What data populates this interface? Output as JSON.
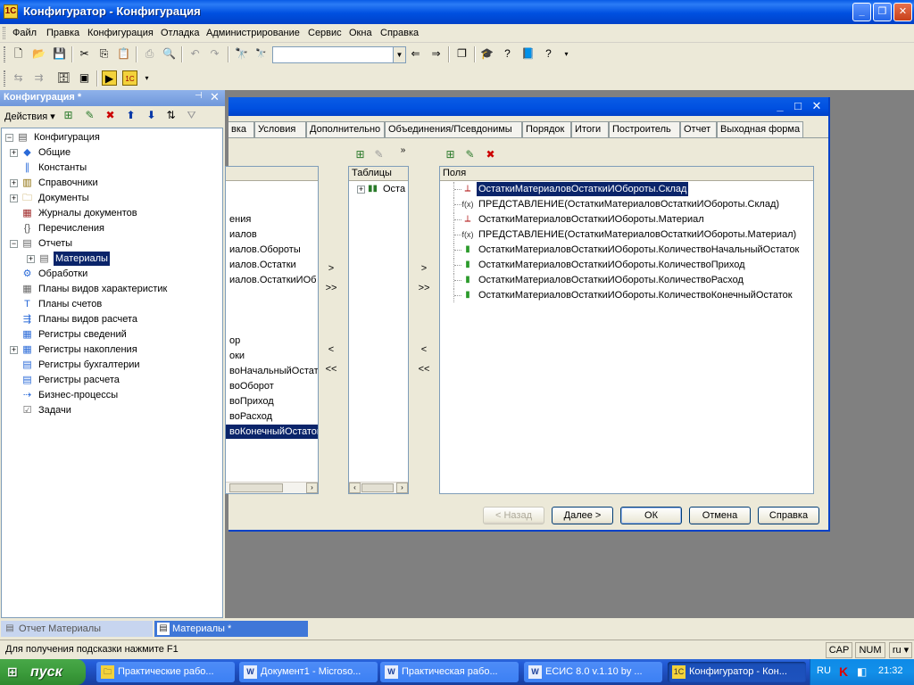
{
  "window": {
    "title": "Конфигуратор - Конфигурация",
    "icon": "1c-app-icon"
  },
  "menu": [
    "Файл",
    "Правка",
    "Конфигурация",
    "Отладка",
    "Администрирование",
    "Сервис",
    "Окна",
    "Справка"
  ],
  "config_panel": {
    "title": "Конфигурация *",
    "actions_label": "Действия",
    "tree": [
      {
        "label": "Конфигурация",
        "icon": "config-icon",
        "level": 0,
        "expander": "minus"
      },
      {
        "label": "Общие",
        "icon": "common-icon",
        "level": 1,
        "expander": "plus"
      },
      {
        "label": "Константы",
        "icon": "constants-icon",
        "level": 1,
        "expander": ""
      },
      {
        "label": "Справочники",
        "icon": "catalogs-icon",
        "level": 1,
        "expander": "plus"
      },
      {
        "label": "Документы",
        "icon": "documents-icon",
        "level": 1,
        "expander": "plus"
      },
      {
        "label": "Журналы документов",
        "icon": "journals-icon",
        "level": 1,
        "expander": ""
      },
      {
        "label": "Перечисления",
        "icon": "enums-icon",
        "level": 1,
        "expander": ""
      },
      {
        "label": "Отчеты",
        "icon": "reports-icon",
        "level": 1,
        "expander": "minus"
      },
      {
        "label": "Материалы",
        "icon": "report-icon",
        "level": 2,
        "expander": "plus",
        "selected": true
      },
      {
        "label": "Обработки",
        "icon": "dataprocessors-icon",
        "level": 1,
        "expander": ""
      },
      {
        "label": "Планы видов характеристик",
        "icon": "chart-of-characteristics-icon",
        "level": 1,
        "expander": ""
      },
      {
        "label": "Планы счетов",
        "icon": "chart-of-accounts-icon",
        "level": 1,
        "expander": ""
      },
      {
        "label": "Планы видов расчета",
        "icon": "chart-of-calculation-icon",
        "level": 1,
        "expander": ""
      },
      {
        "label": "Регистры сведений",
        "icon": "info-registers-icon",
        "level": 1,
        "expander": ""
      },
      {
        "label": "Регистры накопления",
        "icon": "accumulation-registers-icon",
        "level": 1,
        "expander": "plus"
      },
      {
        "label": "Регистры бухгалтерии",
        "icon": "accounting-registers-icon",
        "level": 1,
        "expander": ""
      },
      {
        "label": "Регистры расчета",
        "icon": "calculation-registers-icon",
        "level": 1,
        "expander": ""
      },
      {
        "label": "Бизнес-процессы",
        "icon": "business-processes-icon",
        "level": 1,
        "expander": ""
      },
      {
        "label": "Задачи",
        "icon": "tasks-icon",
        "level": 1,
        "expander": ""
      }
    ]
  },
  "dialog": {
    "tabs": [
      "вка",
      "Условия",
      "Дополнительно",
      "Объединения/Псевдонимы",
      "Порядок",
      "Итоги",
      "Построитель",
      "Отчет",
      "Выходная форма"
    ],
    "left_list": {
      "items": [
        "ения",
        "иалов",
        "иалов.Обороты",
        "иалов.Остатки",
        "иалов.ОстаткиИОб",
        "ор",
        "оки",
        "воНачальныйОстато",
        "воОборот",
        "воПриход",
        "воРасход",
        "воКонечныйОстаток"
      ],
      "selected_index": 11
    },
    "tables": {
      "header": "Таблицы",
      "items": [
        "Оста"
      ]
    },
    "fields": {
      "header": "Поля",
      "items": [
        {
          "text": "ОстаткиМатериаловОстаткиИОбороты.Склад",
          "icon": "dimension-icon",
          "selected": true
        },
        {
          "text": "ПРЕДСТАВЛЕНИЕ(ОстаткиМатериаловОстаткиИОбороты.Склад)",
          "icon": "function-icon"
        },
        {
          "text": "ОстаткиМатериаловОстаткиИОбороты.Материал",
          "icon": "dimension-icon"
        },
        {
          "text": "ПРЕДСТАВЛЕНИЕ(ОстаткиМатериаловОстаткиИОбороты.Материал)",
          "icon": "function-icon"
        },
        {
          "text": "ОстаткиМатериаловОстаткиИОбороты.КоличествоНачальныйОстаток",
          "icon": "resource-icon"
        },
        {
          "text": "ОстаткиМатериаловОстаткиИОбороты.КоличествоПриход",
          "icon": "resource-icon"
        },
        {
          "text": "ОстаткиМатериаловОстаткиИОбороты.КоличествоРасход",
          "icon": "resource-icon"
        },
        {
          "text": "ОстаткиМатериаловОстаткиИОбороты.КоличествоКонечныйОстаток",
          "icon": "resource-icon"
        }
      ]
    },
    "move_buttons": {
      "add": ">",
      "add_all": ">>",
      "remove": "<",
      "remove_all": "<<"
    },
    "buttons": {
      "back": "< Назад",
      "next": "Далее >",
      "ok": "ОК",
      "cancel": "Отмена",
      "help": "Справка"
    }
  },
  "window_tabs": [
    {
      "label": "Отчет Материалы",
      "active": false
    },
    {
      "label": "Материалы *",
      "active": true
    }
  ],
  "status": {
    "hint": "Для получения подсказки нажмите F1",
    "cap": "CAP",
    "num": "NUM",
    "lang": "ru"
  },
  "taskbar": {
    "start": "пуск",
    "tasks": [
      {
        "label": "Практические рабо...",
        "icon": "folder-icon"
      },
      {
        "label": "Документ1 - Microso...",
        "icon": "word-icon"
      },
      {
        "label": "Практическая рабо...",
        "icon": "word-icon"
      },
      {
        "label": "ЕСИС 8.0 v.1.10 by ...",
        "icon": "word-icon"
      },
      {
        "label": "Конфигуратор - Кон...",
        "icon": "1c-app-icon",
        "active": true
      }
    ],
    "tray_lang": "RU",
    "clock": "21:32"
  },
  "colors": {
    "xp_blue": "#0050e0",
    "selection": "#0a246a",
    "taskbar_green": "#3c9c3c"
  }
}
